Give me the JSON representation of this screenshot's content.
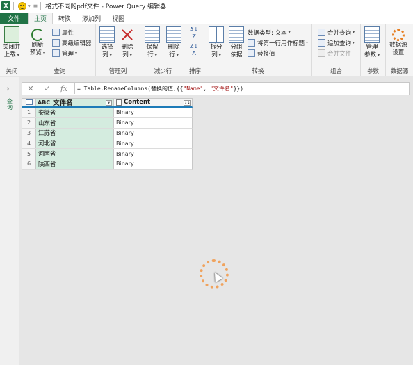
{
  "titlebar": {
    "app_icon": "X",
    "qa_icon": "smiley-icon",
    "title": "格式不同的pdf文件 - Power Query 编辑器"
  },
  "tabs": [
    {
      "label": "文件"
    },
    {
      "label": "主页"
    },
    {
      "label": "转换"
    },
    {
      "label": "添加列"
    },
    {
      "label": "视图"
    }
  ],
  "ribbon": {
    "close": {
      "btn1": "关闭并",
      "btn1b": "上载",
      "group": "关闭"
    },
    "query": {
      "refresh1": "刷新",
      "refresh2": "预览",
      "props": "属性",
      "adv": "高级编辑器",
      "manage": "管理",
      "group": "查询"
    },
    "managecols": {
      "choose1": "选择",
      "choose2": "列",
      "remove1": "删除",
      "remove2": "列",
      "group": "管理列"
    },
    "reducerows": {
      "keep1": "保留",
      "keep2": "行",
      "del1": "删除",
      "del2": "行",
      "group": "减少行"
    },
    "sort": {
      "group": "排序"
    },
    "transform": {
      "split1": "拆分",
      "split2": "列",
      "groupby1": "分组",
      "groupby2": "依据",
      "dtype": "数据类型: 文本",
      "firstrow": "将第一行用作标题",
      "replace": "替换值",
      "group": "转换"
    },
    "combine": {
      "merge": "合并查询",
      "append": "追加查询",
      "combinefiles": "合并文件",
      "group": "组合"
    },
    "params": {
      "manage1": "管理",
      "manage2": "参数",
      "group": "参数"
    },
    "datasource": {
      "settings1": "数据源",
      "settings2": "设置",
      "group": "数据源"
    }
  },
  "sidepane": {
    "label": "查询"
  },
  "formula": {
    "prefix": "= Table.RenameColumns(替换的值,{{",
    "s1": "\"Name\"",
    "mid": ", ",
    "s2": "\"文件名\"",
    "suffix": "}})"
  },
  "grid": {
    "type_label": "ABC",
    "col1": "文件名",
    "col2": "Content",
    "rows": [
      {
        "n": "1",
        "name": "安徽省",
        "content": "Binary"
      },
      {
        "n": "2",
        "name": "山东省",
        "content": "Binary"
      },
      {
        "n": "3",
        "name": "江苏省",
        "content": "Binary"
      },
      {
        "n": "4",
        "name": "河北省",
        "content": "Binary"
      },
      {
        "n": "5",
        "name": "河南省",
        "content": "Binary"
      },
      {
        "n": "6",
        "name": "陕西省",
        "content": "Binary"
      }
    ]
  }
}
